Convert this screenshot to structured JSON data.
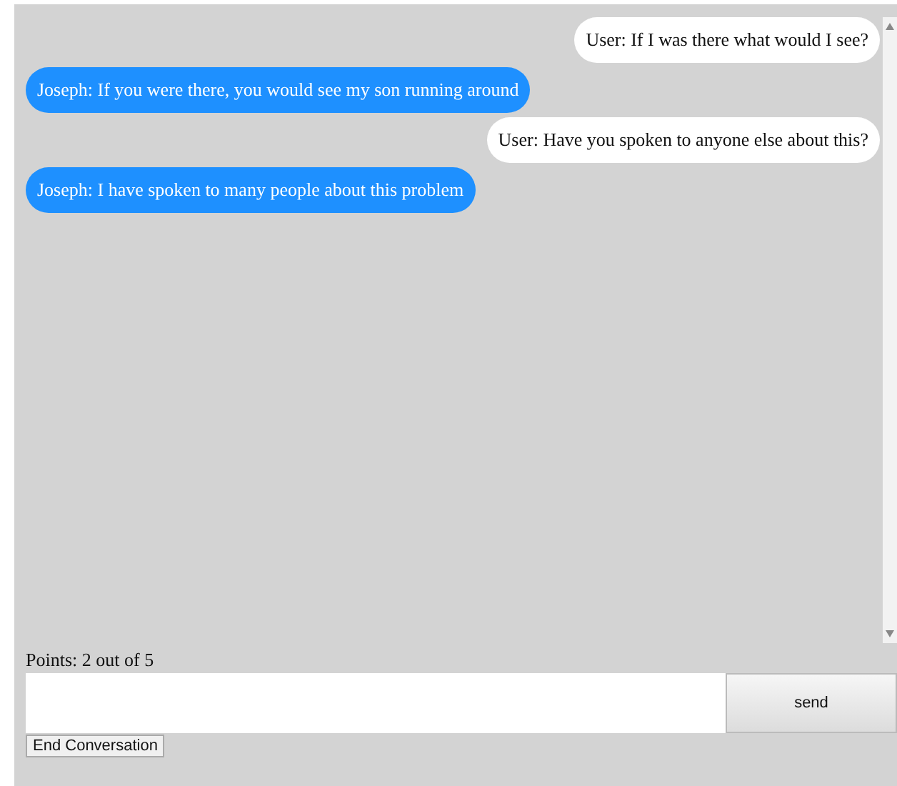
{
  "messages": [
    {
      "kind": "user",
      "text": "User: If I was there what would I see?"
    },
    {
      "kind": "bot",
      "text": "Joseph: If you were there, you would see my son running around"
    },
    {
      "kind": "user",
      "text": "User: Have you spoken to anyone else about this?"
    },
    {
      "kind": "bot",
      "text": "Joseph: I have spoken to many people about this problem"
    }
  ],
  "points": "Points: 2 out of 5",
  "send_button": "send",
  "end_button": "End Conversation"
}
